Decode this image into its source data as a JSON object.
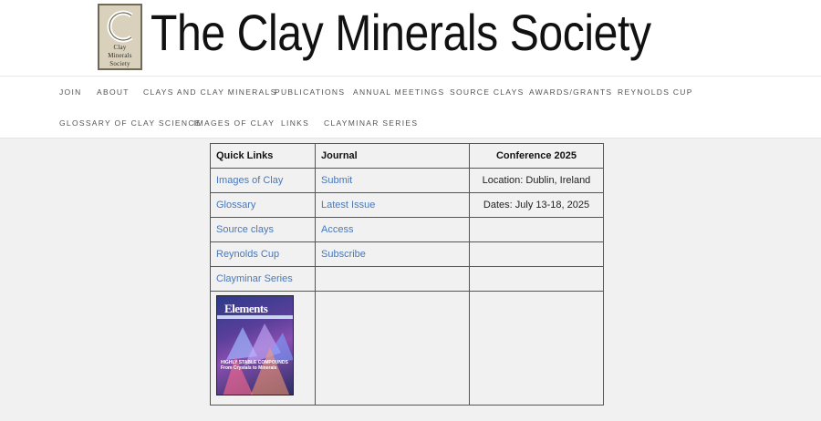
{
  "logo": {
    "line1": "Clay",
    "line2": "Minerals",
    "line3": "Society"
  },
  "site_title": "The Clay Minerals Society",
  "nav": {
    "row1": [
      "JOIN",
      "ABOUT",
      "CLAYS AND CLAY MINERALS",
      "PUBLICATIONS",
      "ANNUAL MEETINGS",
      "SOURCE CLAYS",
      "AWARDS/GRANTS",
      "REYNOLDS CUP"
    ],
    "row2": [
      "GLOSSARY OF CLAY SCIENCE",
      "IMAGES OF CLAY",
      "LINKS",
      "CLAYMINAR SERIES"
    ]
  },
  "table": {
    "headers": [
      "Quick Links",
      "Journal",
      "Conference 2025"
    ],
    "quick_links": [
      "Images of Clay",
      "Glossary",
      "Source clays",
      "Reynolds Cup",
      "Clayminar Series"
    ],
    "journal": [
      "Submit",
      "Latest Issue",
      "Access",
      "Subscribe"
    ],
    "conference": [
      "Location: Dublin, Ireland",
      "Dates: July 13-18, 2025"
    ]
  },
  "cover": {
    "title": "Elements",
    "subtitle": "HIGHLY STABLE COMPOUNDS From Crystals to Minerals"
  },
  "colors": {
    "link": "#4a78b8",
    "background": "#f1f1f1"
  }
}
